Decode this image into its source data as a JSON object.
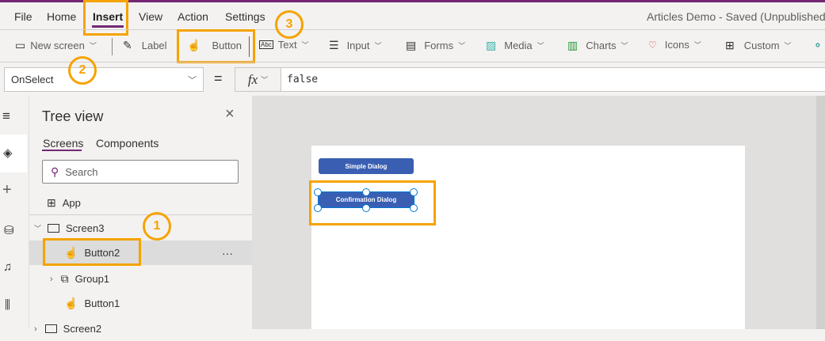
{
  "menu": {
    "items": [
      "File",
      "Home",
      "Insert",
      "View",
      "Action",
      "Settings"
    ],
    "active": "Insert"
  },
  "app_status": "Articles Demo - Saved (Unpublished)",
  "toolbar": {
    "new_screen": "New screen",
    "label": "Label",
    "button": "Button",
    "text": "Text",
    "input": "Input",
    "forms": "Forms",
    "media": "Media",
    "charts": "Charts",
    "icons": "Icons",
    "custom": "Custom"
  },
  "formula": {
    "property": "OnSelect",
    "equals": "=",
    "fx": "fx",
    "value": "false"
  },
  "tree": {
    "title": "Tree view",
    "tabs": [
      "Screens",
      "Components"
    ],
    "search_placeholder": "Search",
    "items": [
      "App",
      "Screen3",
      "Button2",
      "Group1",
      "Button1",
      "Screen2"
    ],
    "more": "···"
  },
  "canvas": {
    "buttons": [
      "Simple Dialog",
      "Confirmation Dialog"
    ]
  },
  "callouts": [
    "1",
    "2",
    "3"
  ],
  "colors": {
    "accent": "#742774",
    "highlight": "#f5a300",
    "button": "#3a5fb2"
  }
}
